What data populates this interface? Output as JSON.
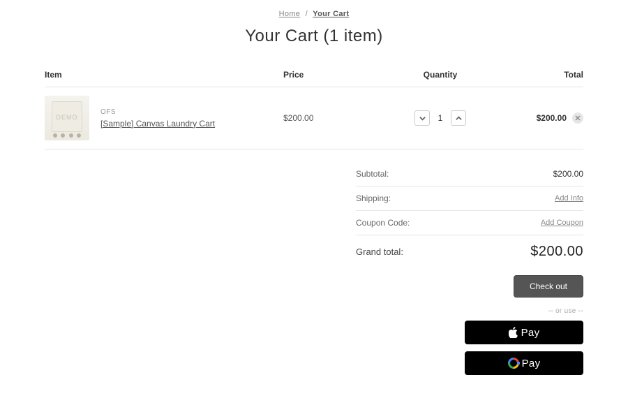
{
  "breadcrumb": {
    "home": "Home",
    "current": "Your Cart"
  },
  "title": "Your Cart (1 item)",
  "headers": {
    "item": "Item",
    "price": "Price",
    "qty": "Quantity",
    "total": "Total"
  },
  "items": [
    {
      "brand": "OFS",
      "name": "[Sample] Canvas Laundry Cart",
      "price": "$200.00",
      "qty": "1",
      "total": "$200.00"
    }
  ],
  "summary": {
    "subtotal_label": "Subtotal:",
    "subtotal_value": "$200.00",
    "shipping_label": "Shipping:",
    "shipping_action": "Add Info",
    "coupon_label": "Coupon Code:",
    "coupon_action": "Add Coupon",
    "grand_label": "Grand total:",
    "grand_value": "$200.00"
  },
  "checkout_label": "Check out",
  "or_use": "-- or use --",
  "apple_pay": "Pay",
  "google_pay": "Pay"
}
